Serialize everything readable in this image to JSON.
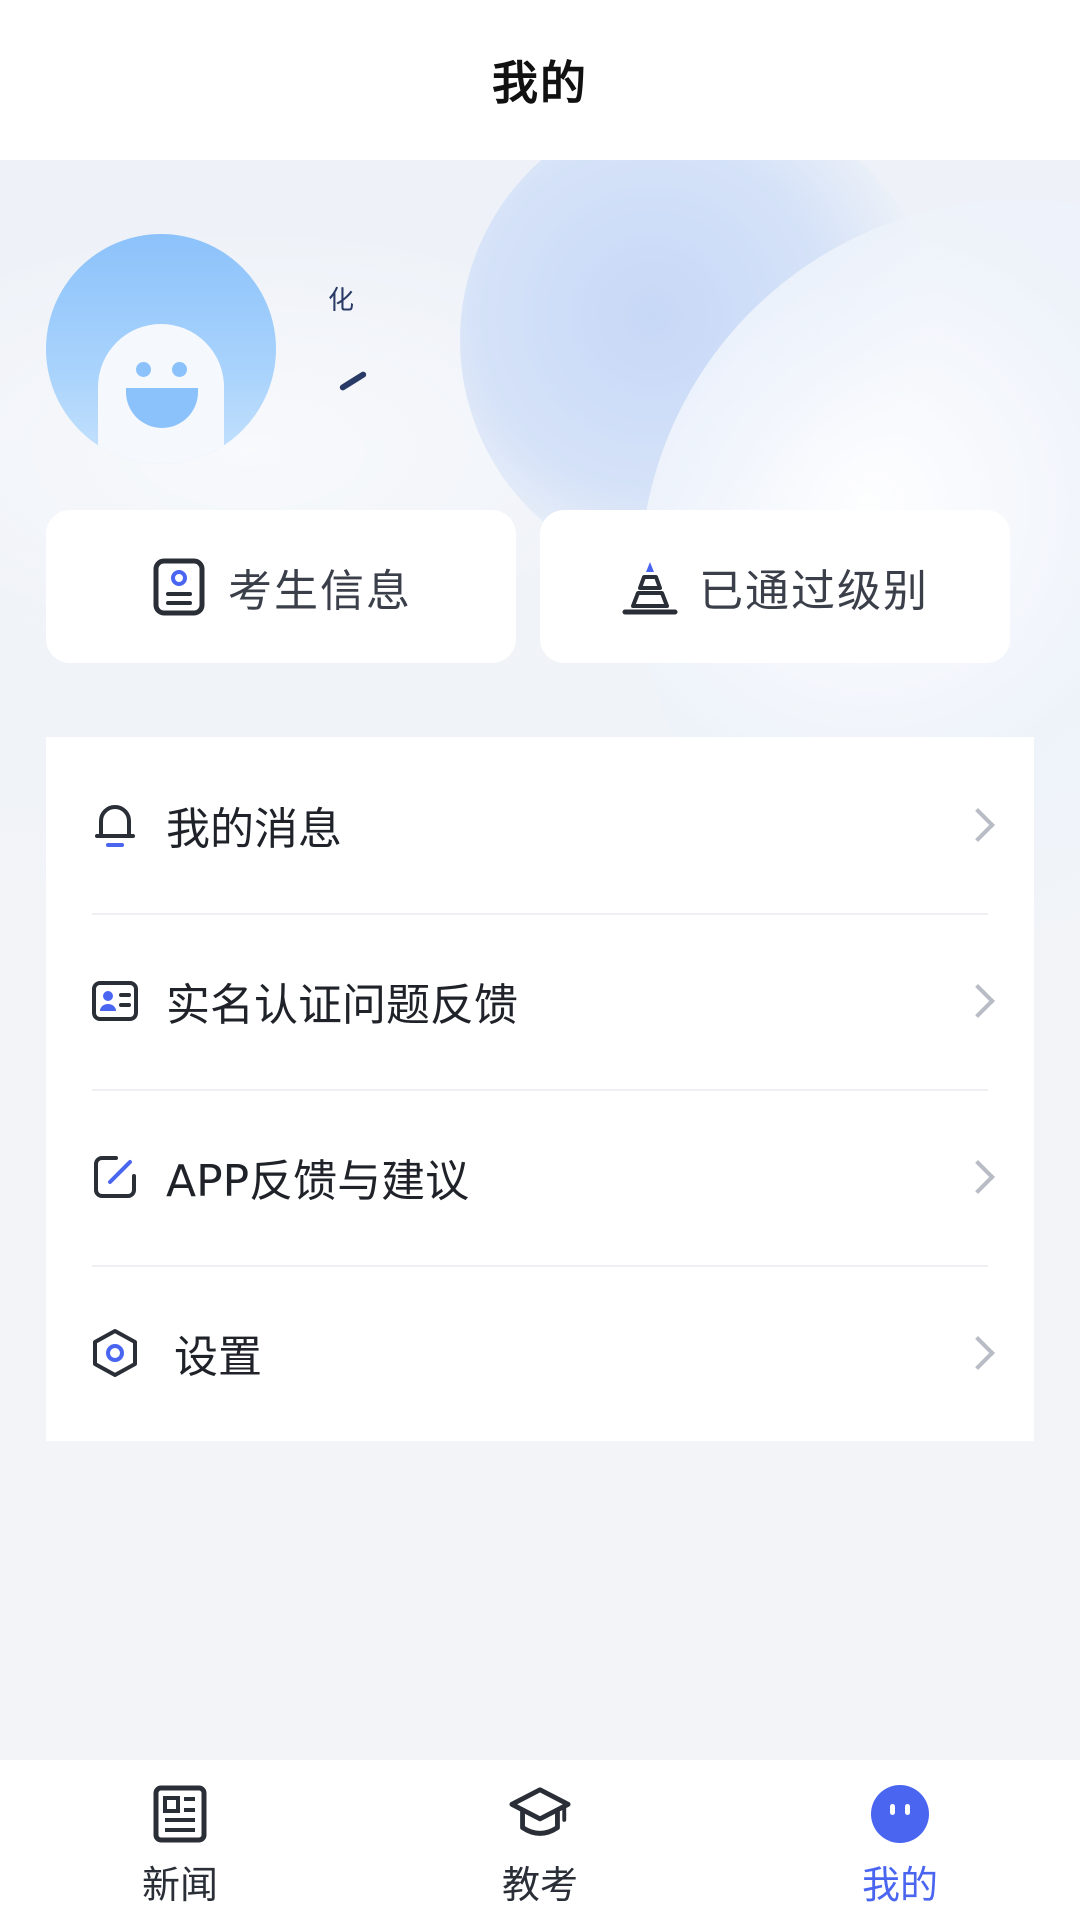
{
  "header": {
    "title": "我的"
  },
  "profile": {
    "username_fragment": "化"
  },
  "cards": [
    {
      "label": "考生信息",
      "icon": "id-card-icon"
    },
    {
      "label": "已通过级别",
      "icon": "pyramid-level-icon"
    }
  ],
  "menu": {
    "items": [
      {
        "label": "我的消息",
        "icon": "bell-icon"
      },
      {
        "label": "实名认证问题反馈",
        "icon": "id-card-feedback-icon"
      },
      {
        "label": "APP反馈与建议",
        "icon": "edit-icon"
      },
      {
        "label": "设置",
        "icon": "settings-hexagon-icon"
      }
    ]
  },
  "tabbar": {
    "active": "我的",
    "tabs": [
      {
        "label": "新闻",
        "icon": "newspaper-icon"
      },
      {
        "label": "教考",
        "icon": "graduation-cap-icon"
      },
      {
        "label": "我的",
        "icon": "mascot-face-icon"
      }
    ]
  },
  "colors": {
    "accent": "#4a66f1",
    "avatar": "#8cc2fb",
    "background": "#f3f4f7"
  }
}
